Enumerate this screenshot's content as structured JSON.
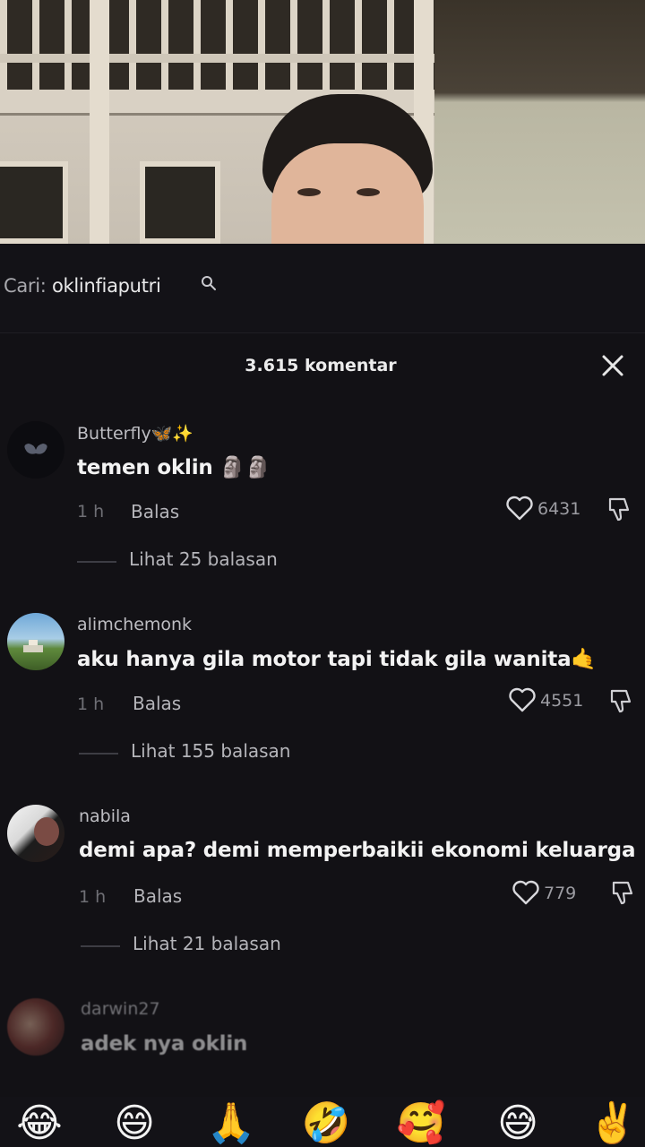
{
  "search": {
    "prefix": "Cari:",
    "query": "oklinfiaputri"
  },
  "header": {
    "comment_count": "3.615 komentar"
  },
  "comments": [
    {
      "username": "Butterfly🦋✨",
      "text": "temen oklin 🗿🗿",
      "time": "1 h",
      "reply_label": "Balas",
      "likes": "6431",
      "view_replies": "Lihat 25 balasan",
      "avatar": "butterfly-avatar"
    },
    {
      "username": "alimchemonk",
      "text": "aku hanya gila motor tapi tidak gila wanita🤙",
      "time": "1 h",
      "reply_label": "Balas",
      "likes": "4551",
      "view_replies": "Lihat 155 balasan",
      "avatar": "landscape-avatar"
    },
    {
      "username": "nabila",
      "text": "demi apa? demi memperbaikii ekonomi keluarga",
      "time": "1 h",
      "reply_label": "Balas",
      "likes": "779",
      "view_replies": "Lihat 21 balasan",
      "avatar": "portrait-avatar"
    },
    {
      "username": "darwin27",
      "text": "adek nya oklin",
      "time": "",
      "reply_label": "",
      "likes": "",
      "view_replies": "",
      "avatar": "portrait-avatar-red"
    }
  ],
  "emojis": [
    "😂",
    "😄",
    "🙏",
    "🤣",
    "🥰",
    "😅",
    "✌️"
  ],
  "colors": {
    "background": "#121115",
    "text": "#f3f3f3",
    "muted": "#6f6f75"
  }
}
